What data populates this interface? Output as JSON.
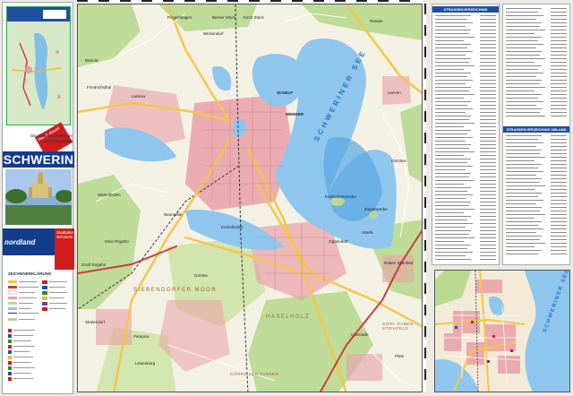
{
  "cover": {
    "title": "SCHWERIN",
    "badge": "Neu & aktuell",
    "description": "Die Übersichtskarte der Landeshauptstadt",
    "brand": "nordland",
    "side_label": "Stadtplan Schwerin",
    "legend_title": "ZEICHENERKLÄRUNG"
  },
  "map": {
    "places": [
      {
        "id": "pingelshagen",
        "text": "Pingelshagen"
      },
      {
        "id": "berner-stueck",
        "text": "Berner Stück"
      },
      {
        "id": "kirch-stueck",
        "text": "Kirch Stück"
      },
      {
        "id": "raeisa",
        "text": "Rampe"
      },
      {
        "id": "wickendorf",
        "text": "Wickendorf"
      },
      {
        "id": "lankow",
        "text": "Lankow"
      },
      {
        "id": "friedrichsthal",
        "text": "Friedrichsthal"
      },
      {
        "id": "warnitz",
        "text": "Warnitz"
      },
      {
        "id": "wittenfoerden",
        "text": "Wittenförden"
      },
      {
        "id": "klein-rogahn",
        "text": "Klein Rogahn"
      },
      {
        "id": "gross-rogahn",
        "text": "Groß Rogahn"
      },
      {
        "id": "stralendorf",
        "text": "Stralendorf"
      },
      {
        "id": "pampow",
        "text": "Pampow"
      },
      {
        "id": "lewenberg",
        "text": "Lewenberg"
      },
      {
        "id": "werder",
        "text": "WERDER"
      },
      {
        "id": "schelf",
        "text": "SCHELF"
      },
      {
        "id": "leezen",
        "text": "Leezen"
      },
      {
        "id": "goehren",
        "text": "Görslow"
      },
      {
        "id": "raben-steinfeld",
        "text": "Raben Steinfeld"
      },
      {
        "id": "consrade",
        "text": "Consrade"
      },
      {
        "id": "plate",
        "text": "Plate"
      },
      {
        "id": "zippendorf",
        "text": "Zippendorf"
      },
      {
        "id": "muess",
        "text": "Mueß"
      },
      {
        "id": "kaninchenwerder",
        "text": "Kaninchenwerder"
      },
      {
        "id": "ziegelwerder",
        "text": "Ziegelwerder"
      },
      {
        "id": "goerries",
        "text": "Görries"
      },
      {
        "id": "krebsfoerden",
        "text": "Krebsförden"
      },
      {
        "id": "neumuehle",
        "text": "Neumühle"
      }
    ],
    "lake_label": "SCHWERINER SEE",
    "area_labels": [
      {
        "id": "sieben-moor",
        "text": "SIEBENDORFER MOOR"
      },
      {
        "id": "haselholz",
        "text": "HASELHOLZ"
      },
      {
        "id": "dorf-raben",
        "text": "DORF RABEN STEINFELD"
      },
      {
        "id": "goerrieser-tannen",
        "text": "GÖRRIESER TANNEN"
      }
    ]
  },
  "index": {
    "head1": "STRASSENVERZEICHNIS",
    "head2": "STRASSENVERZEICHNIS UMLAND"
  },
  "inset": {
    "lake_label": "SCHWERINER SEE"
  },
  "colors": {
    "water": "#8ec6ee",
    "water_deep": "#5aa6e2",
    "forest": "#b9d98f",
    "urban": "#e9a0a8",
    "road_major": "#f4c646",
    "road_red": "#d23a3a",
    "navy": "#143c8c",
    "red": "#d21c1c"
  }
}
